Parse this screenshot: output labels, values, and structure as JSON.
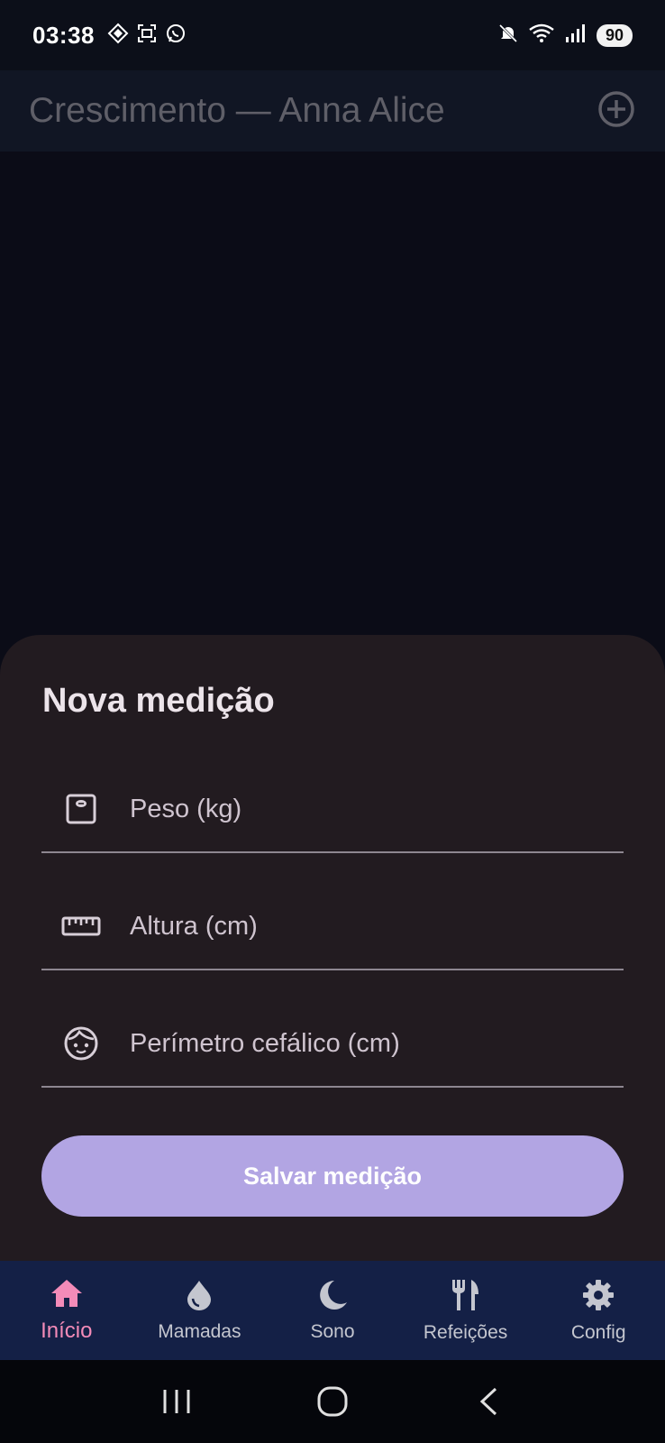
{
  "status_bar": {
    "time": "03:38",
    "battery": "90",
    "left_icons": [
      "diamond-app-icon",
      "screenshot-icon",
      "whatsapp-icon"
    ],
    "right_icons": [
      "mute-icon",
      "wifi-icon",
      "signal-icon",
      "battery-icon"
    ]
  },
  "app_bar": {
    "title": "Crescimento — Anna Alice",
    "action_icon": "add-circle-icon"
  },
  "sheet": {
    "title": "Nova medição",
    "fields": [
      {
        "icon": "scale-icon",
        "placeholder": "Peso (kg)",
        "value": ""
      },
      {
        "icon": "ruler-icon",
        "placeholder": "Altura (cm)",
        "value": ""
      },
      {
        "icon": "baby-face-icon",
        "placeholder": "Perímetro cefálico (cm)",
        "value": ""
      }
    ],
    "save_label": "Salvar medição"
  },
  "bottom_nav": {
    "items": [
      {
        "label": "Início",
        "icon": "home-icon",
        "active": true
      },
      {
        "label": "Mamadas",
        "icon": "drop-icon",
        "active": false
      },
      {
        "label": "Sono",
        "icon": "moon-icon",
        "active": false
      },
      {
        "label": "Refeições",
        "icon": "fork-knife-icon",
        "active": false
      },
      {
        "label": "Config",
        "icon": "gear-icon",
        "active": false
      }
    ]
  },
  "colors": {
    "accent_button": "#b2a5e3",
    "active_nav": "#f38bb8",
    "nav_background": "#142046",
    "sheet_background": "#221b20"
  }
}
